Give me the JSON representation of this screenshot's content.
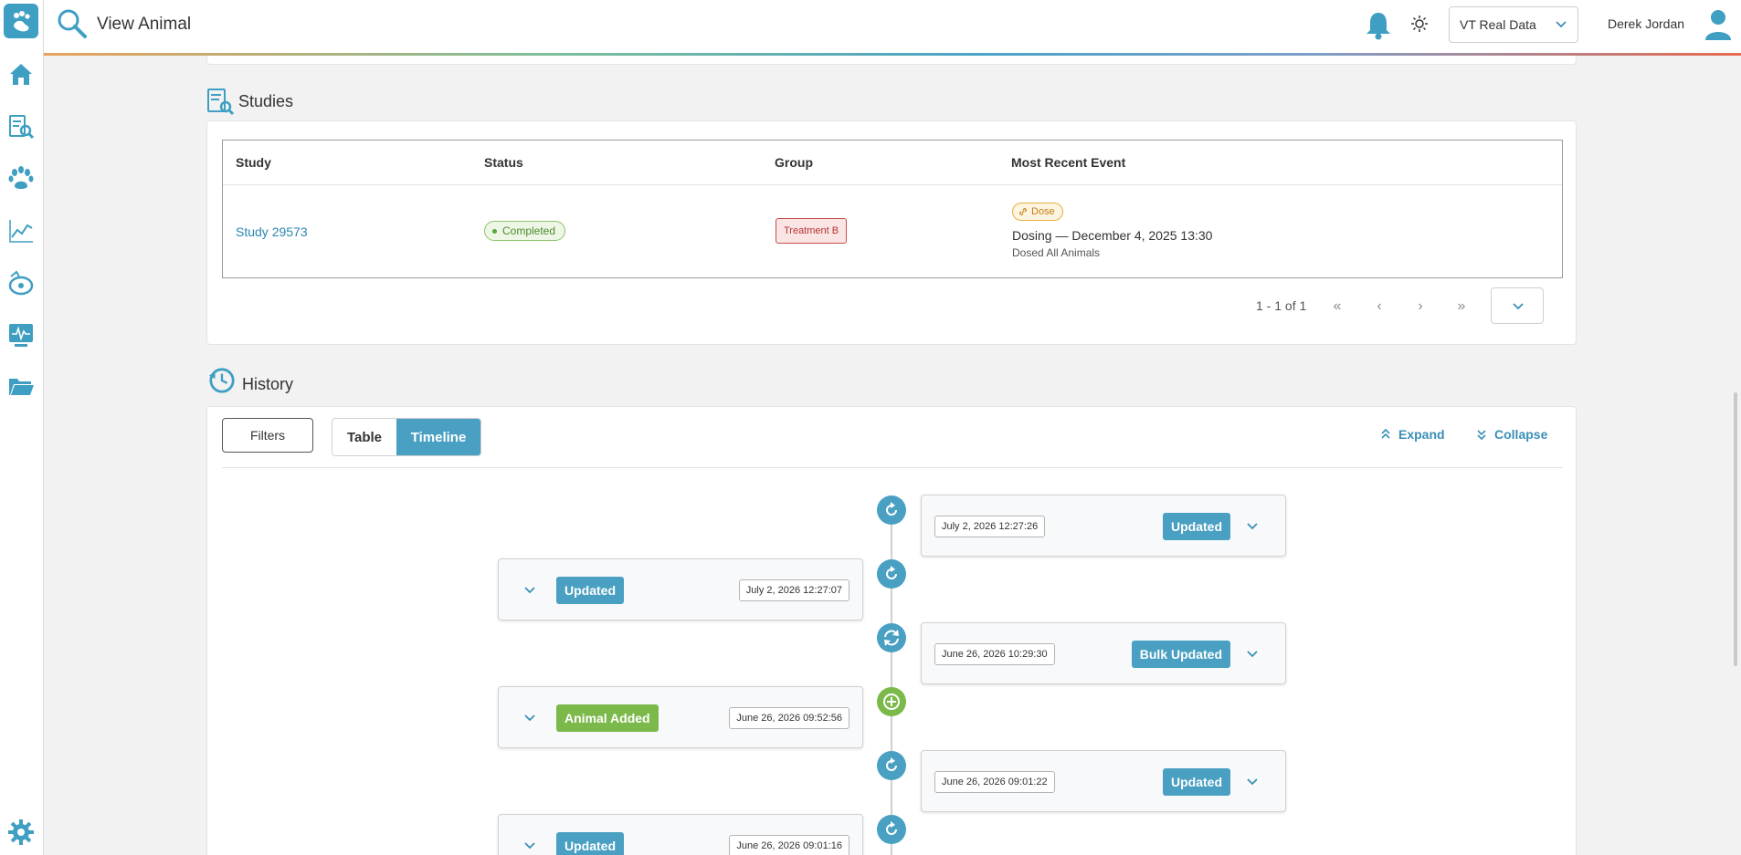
{
  "header": {
    "title": "View Animal",
    "dataset_select": "VT Real Data",
    "user_name": "Derek Jordan"
  },
  "sidebar": {
    "items": [
      {
        "icon": "home-icon"
      },
      {
        "icon": "study-search-icon"
      },
      {
        "icon": "paw-icon"
      },
      {
        "icon": "chart-icon"
      },
      {
        "icon": "dosing-icon"
      },
      {
        "icon": "monitor-icon"
      },
      {
        "icon": "folder-icon"
      },
      {
        "icon": "gear-icon"
      }
    ]
  },
  "studies": {
    "section_title": "Studies",
    "columns": [
      "Study",
      "Status",
      "Group",
      "Most Recent Event"
    ],
    "rows": [
      {
        "study": "Study 29573",
        "status": "Completed",
        "group": "Treatment B",
        "event_badge": "Dose",
        "event_title": "Dosing — December 4, 2025 13:30",
        "event_sub": "Dosed All Animals"
      }
    ],
    "pagination": {
      "range_text": "1 - 1 of 1",
      "first": "«",
      "prev": "‹",
      "next": "›",
      "last": "»"
    }
  },
  "history": {
    "section_title": "History",
    "filters_label": "Filters",
    "view_tabs": [
      "Table",
      "Timeline"
    ],
    "active_tab": "Timeline",
    "expand_label": "Expand",
    "collapse_label": "Collapse",
    "timeline": [
      {
        "side": "right",
        "time": "July 2, 2026 12:27:26",
        "label": "Updated",
        "type": "update",
        "color": "#4aa0c2"
      },
      {
        "side": "left",
        "time": "July 2, 2026 12:27:07",
        "label": "Updated",
        "type": "update",
        "color": "#4aa0c2"
      },
      {
        "side": "right",
        "time": "June 26, 2026 10:29:30",
        "label": "Bulk Updated",
        "type": "bulk",
        "color": "#4aa0c2"
      },
      {
        "side": "left",
        "time": "June 26, 2026 09:52:56",
        "label": "Animal Added",
        "type": "add",
        "color": "#7cb94b"
      },
      {
        "side": "right",
        "time": "June 26, 2026 09:01:22",
        "label": "Updated",
        "type": "update",
        "color": "#4aa0c2"
      },
      {
        "side": "left",
        "time": "June 26, 2026 09:01:16",
        "label": "Updated",
        "type": "update",
        "color": "#4aa0c2"
      }
    ]
  },
  "colors": {
    "accent": "#4aa0c2",
    "success": "#7cb94b",
    "danger": "#c84b4b",
    "warning": "#e6b13c"
  }
}
